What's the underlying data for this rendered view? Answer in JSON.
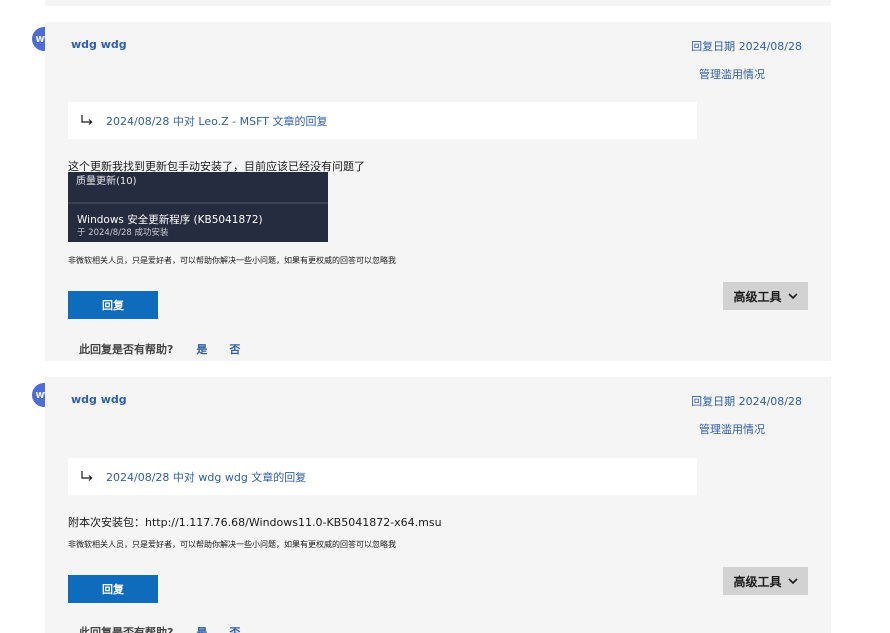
{
  "replies": [
    {
      "avatar_initials": "WW",
      "author": "wdg wdg",
      "reply_date": "回复日期 2024/08/28",
      "report_label": "管理滥用情况",
      "reply_ref": "2024/08/28 中对 Leo.Z - MSFT 文章的回复",
      "body": "这个更新我找到更新包手动安装了，目前应该已经没有问题了",
      "screenshot": {
        "line1": "质量更新(10)",
        "line2": "Windows 安全更新程序 (KB5041872)",
        "line3": "于 2024/8/28 成功安装"
      },
      "disclaimer": "非微软相关人员，只是爱好者，可以帮助你解决一些小问题，如果有更权威的回答可以忽略我",
      "reply_button": "回复",
      "advanced_tools": "高级工具",
      "helpful_question": "此回复是否有帮助?",
      "helpful_yes": "是",
      "helpful_no": "否"
    },
    {
      "avatar_initials": "WW",
      "author": "wdg wdg",
      "reply_date": "回复日期 2024/08/28",
      "report_label": "管理滥用情况",
      "reply_ref": "2024/08/28 中对 wdg wdg 文章的回复",
      "body": "附本次安装包：http://1.117.76.68/Windows11.0-KB5041872-x64.msu",
      "disclaimer": "非微软相关人员，只是爱好者，可以帮助你解决一些小问题，如果有更权威的回答可以忽略我",
      "reply_button": "回复",
      "advanced_tools": "高级工具",
      "helpful_question": "此回复是否有帮助?",
      "helpful_yes": "是",
      "helpful_no": "否"
    }
  ],
  "colors": {
    "accent": "#0f6cbd",
    "link": "#2f5fa8",
    "card_bg": "#f5f5f5",
    "avatar": "#4f6bd8"
  }
}
